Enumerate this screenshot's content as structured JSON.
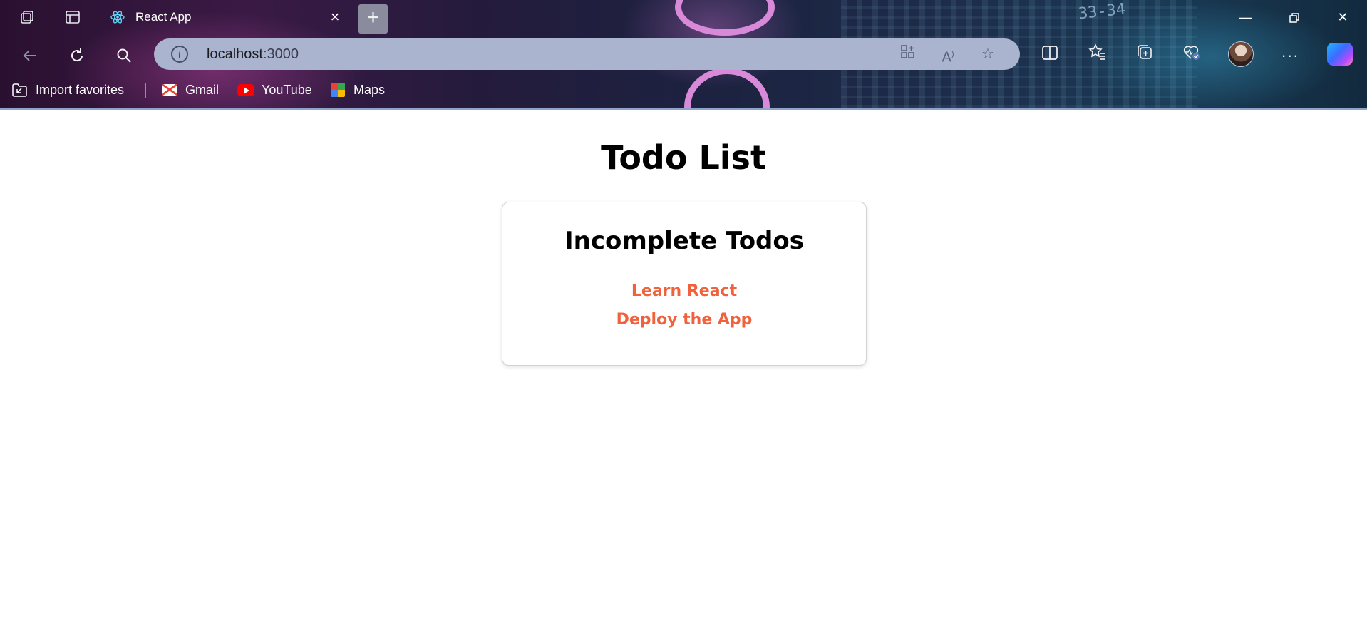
{
  "browser": {
    "tab": {
      "title": "React App",
      "favicon": "react-atom-icon"
    },
    "address": {
      "host": "localhost",
      "port": ":3000"
    },
    "favorites": [
      {
        "label": "Import favorites",
        "icon": "import-favorites-icon"
      },
      {
        "label": "Gmail",
        "icon": "gmail-icon"
      },
      {
        "label": "YouTube",
        "icon": "youtube-icon"
      },
      {
        "label": "Maps",
        "icon": "maps-icon"
      }
    ],
    "background_label": "33-34",
    "colors": {
      "omnibox": "#aab4cf",
      "new_tab_button": "#8b8b9e"
    }
  },
  "page": {
    "title": "Todo List",
    "card": {
      "title": "Incomplete Todos",
      "todos": [
        "Learn React",
        "Deploy the App"
      ]
    },
    "colors": {
      "todo_text": "#f0623c",
      "card_border": "#d2d2d2"
    }
  }
}
